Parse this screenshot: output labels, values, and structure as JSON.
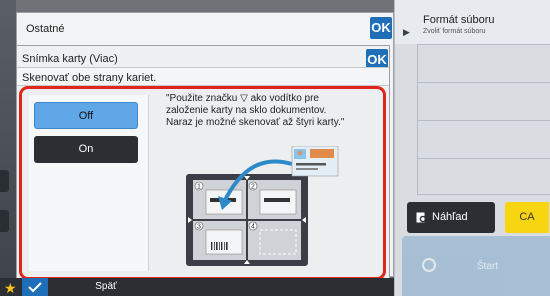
{
  "background_dialog": {
    "title": "Ostatné",
    "ok_label": "OK"
  },
  "dialog": {
    "title": "Snímka karty (Viac)",
    "ok_label": "OK",
    "description": "Skenovať obe strany kariet.",
    "options": [
      {
        "label": "Off",
        "selected": true
      },
      {
        "label": "On",
        "selected": false
      }
    ],
    "message_lines": [
      "\"Použite značku ▽ ako vodítko pre",
      "založenie karty na sklo dokumentov.",
      "Naraz je možné skenovať až štyri karty.\""
    ],
    "illustration_slots": [
      "1",
      "2",
      "3",
      "4"
    ]
  },
  "right_panel": {
    "title": "Formát súboru",
    "subtitle": "Zvoliť formát súboru",
    "preview_label": "Náhľad",
    "ca_label": "CA",
    "start_label": "Štart"
  },
  "bottom": {
    "back_label": "Späť"
  },
  "colors": {
    "accent_blue": "#1f6fb8",
    "selected_option": "#5fa7e6",
    "highlight_red": "#e1251b",
    "ca_yellow": "#f7d510"
  }
}
